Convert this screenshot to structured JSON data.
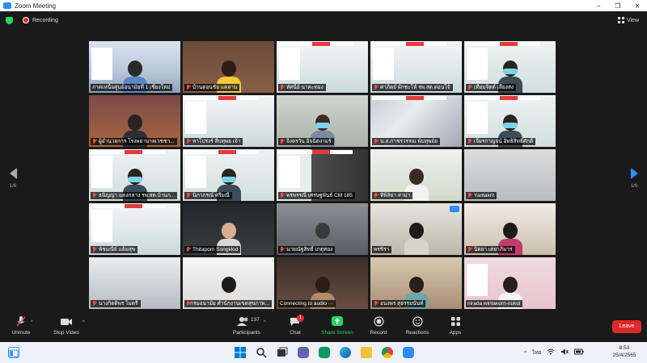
{
  "window": {
    "title": "Zoom Meeting",
    "controls": [
      "–",
      "❐",
      "✕"
    ]
  },
  "topbar": {
    "recording_label": "Recording",
    "view_label": "View"
  },
  "pager": {
    "left": "1/6",
    "right": "1/6"
  },
  "tiles": [
    {
      "name": "ภาคเหนือศูนย์อนามัยที่ 1 เชียงใหม่",
      "scene": "conference",
      "active": true,
      "muted": false
    },
    {
      "name": "บ้านดอนชัย แคลาน",
      "scene": "person-yellow",
      "active": false,
      "muted": true
    },
    {
      "name": "ทัศนีย์ นาคะทอง",
      "scene": "slide",
      "active": false,
      "muted": true
    },
    {
      "name": "ศาภิตย์ ผักชะโห้ รพ.สต.ดอนโจ้",
      "scene": "slide",
      "active": false,
      "muted": true
    },
    {
      "name": "เทียมจิตต์ เลี้ยงสง",
      "scene": "slide-person-mask",
      "active": false,
      "muted": true
    },
    {
      "name": "ผู้อำนวยการ โรงพยาบาลเวชชา...",
      "scene": "person-suit",
      "active": false,
      "muted": true
    },
    {
      "name": "ทาโปร่งร์ สีบทุพย เจ้า",
      "scene": "slide",
      "active": false,
      "muted": true
    },
    {
      "name": "จิ๋งตรวัน อิจฉิตงามร์",
      "scene": "person-mask",
      "active": false,
      "muted": true
    },
    {
      "name": "น.ส.ภาชรวรรณ พับทุพย์ย",
      "scene": "window-light",
      "active": false,
      "muted": true
    },
    {
      "name": "เจียรกาญจน์ อิทธิสิทธิ์ศักดิ์",
      "scene": "slide-person-mask",
      "active": false,
      "muted": true
    },
    {
      "name": "ธนิญญา แดงกลาง รพ.สต.บ้านก...",
      "scene": "slide-person-mask",
      "active": false,
      "muted": true
    },
    {
      "name": "นิภาภรณ์ ศรีมณี",
      "scene": "slide-person-mask",
      "active": false,
      "muted": true
    },
    {
      "name": "พรพรรณี เศรษฐพันธ์ CM 185",
      "scene": "slide-chair",
      "active": false,
      "muted": true
    },
    {
      "name": "ทิพิลิยา สาม่า",
      "scene": "office-woman",
      "active": false,
      "muted": true
    },
    {
      "name": "Yantakrit",
      "scene": "room-light",
      "active": false,
      "muted": true
    },
    {
      "name": "พัชมณีย์ แย้มสุข",
      "scene": "slide",
      "active": false,
      "muted": true
    },
    {
      "name": "Thitaporn Songklod",
      "scene": "person-dark",
      "active": false,
      "muted": true
    },
    {
      "name": "นายณัฐสิทธิ์ เกตุทอง",
      "scene": "room-dim",
      "active": false,
      "muted": true
    },
    {
      "name": "พรชิรา",
      "scene": "person-headphones",
      "active": false,
      "muted": false
    },
    {
      "name": "นิตยา เตยาภิมาร",
      "scene": "person-blackmask",
      "active": false,
      "muted": true
    },
    {
      "name": "นางกิตติพร ไมตรี",
      "scene": "ceiling",
      "active": false,
      "muted": true
    },
    {
      "name": "กรมอนามัย ศำนักงานเขตสุขภาพ...",
      "scene": "person-glasses",
      "active": false,
      "muted": true
    },
    {
      "name": "Connecting to audio ···",
      "scene": "person-blur",
      "active": false,
      "muted": false
    },
    {
      "name": "อนงพร สุธรรมนันท์",
      "scene": "person-room",
      "active": false,
      "muted": true
    },
    {
      "name": "nirada wintakorn-nukul",
      "scene": "person-pink-card",
      "active": false,
      "muted": false
    }
  ],
  "toolbar": {
    "unmute": "Unmute",
    "stop_video": "Stop Video",
    "participants": "Participants",
    "participants_count": "137",
    "chat": "Chat",
    "chat_badge": "1",
    "share_screen": "Share Screen",
    "record": "Record",
    "reactions": "Reactions",
    "apps": "Apps",
    "leave": "Leave"
  },
  "taskbar": {
    "icons": [
      "windows-start-icon",
      "search-icon",
      "task-view-icon",
      "teams-chat-icon",
      "app-icon",
      "edge-icon",
      "file-explorer-icon",
      "chrome-icon",
      "zoom-icon"
    ],
    "tray": {
      "caret": "^",
      "language": "ไทย",
      "wifi": "wifi",
      "volume": "vol",
      "battery": "bat"
    },
    "time": "8:53",
    "date": "25/4/2565"
  },
  "colors": {
    "accent": "#2d8cff",
    "share_green": "#23d959",
    "leave_red": "#e02828",
    "active_speaker": "#f5e342"
  }
}
